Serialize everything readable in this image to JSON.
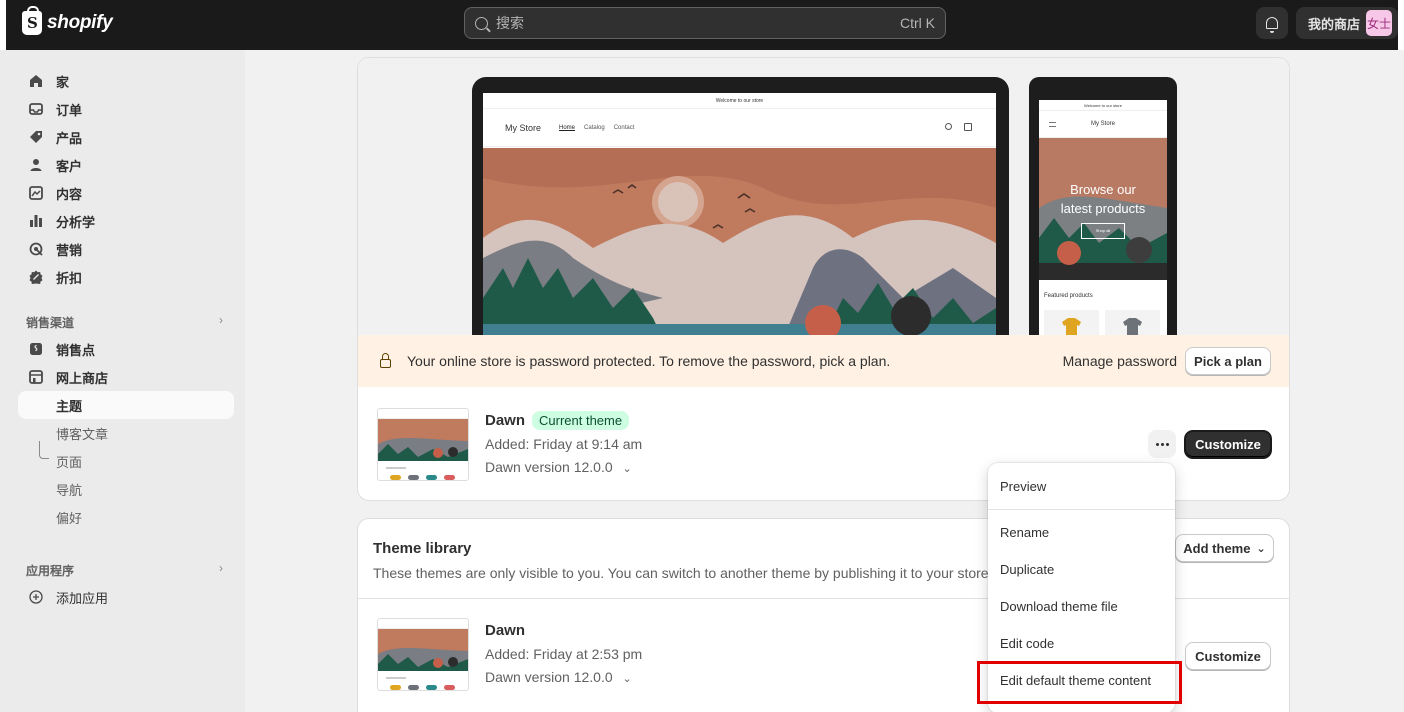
{
  "topbar": {
    "brand": "shopify",
    "search_placeholder": "搜索",
    "search_shortcut": "Ctrl K",
    "store_name": "我的商店",
    "avatar_text": "女士"
  },
  "sidebar": {
    "items": [
      {
        "label": "家",
        "icon": "home-icon"
      },
      {
        "label": "订单",
        "icon": "inbox-icon"
      },
      {
        "label": "产品",
        "icon": "tag-icon"
      },
      {
        "label": "客户",
        "icon": "person-icon"
      },
      {
        "label": "内容",
        "icon": "image-icon"
      },
      {
        "label": "分析学",
        "icon": "bar-chart-icon"
      },
      {
        "label": "营销",
        "icon": "target-icon"
      },
      {
        "label": "折扣",
        "icon": "discount-icon"
      }
    ],
    "sales_channels_title": "销售渠道",
    "channels": [
      {
        "label": "销售点",
        "icon": "pos-icon"
      },
      {
        "label": "网上商店",
        "icon": "store-icon"
      }
    ],
    "sub_items": [
      "主题",
      "博客文章",
      "页面",
      "导航",
      "偏好"
    ],
    "apps_title": "应用程序",
    "add_app": "添加应用"
  },
  "preview": {
    "announcement": "Welcome to our store",
    "store_title": "My Store",
    "nav": [
      "Home",
      "Catalog",
      "Contact"
    ],
    "phone_hero_line1": "Browse our",
    "phone_hero_line2": "latest products",
    "phone_shop_all": "Shop all",
    "phone_featured": "Featured products"
  },
  "banner": {
    "text": "Your online store is password protected. To remove the password, pick a plan.",
    "manage_password": "Manage password",
    "pick_plan": "Pick a plan"
  },
  "current_theme": {
    "name": "Dawn",
    "badge": "Current theme",
    "added": "Added: Friday at 9:14 am",
    "version": "Dawn version 12.0.0",
    "customize": "Customize"
  },
  "library": {
    "title": "Theme library",
    "description": "These themes are only visible to you. You can switch to another theme by publishing it to your store",
    "add_theme": "Add theme",
    "theme": {
      "name": "Dawn",
      "added": "Added: Friday at 2:53 pm",
      "version": "Dawn version 12.0.0",
      "customize": "Customize"
    }
  },
  "menu": {
    "items": [
      "Preview",
      "Rename",
      "Duplicate",
      "Download theme file",
      "Edit code",
      "Edit default theme content"
    ]
  },
  "colors": {
    "topbar_bg": "#1a1a1a",
    "banner_bg": "#fff1e3",
    "badge_bg": "#cdfee1",
    "highlight": "#e00000"
  }
}
